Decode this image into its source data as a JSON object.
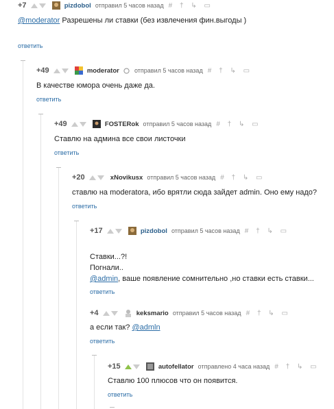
{
  "colors": {
    "link": "#2a6ca6",
    "user": "#2a5e8a",
    "arrow": "#cccccc",
    "arrow_up_active": "#8fc24a"
  },
  "tools_glyph": "# † ↳ ▭",
  "c0": {
    "rating": "+7",
    "user": "pizdobol",
    "sent": "отправил 5 часов назад",
    "mention": "@moderator",
    "text": "Разрешены ли ставки (без извлечения фин.выгоды )",
    "reply": "ответить"
  },
  "c1": {
    "rating": "+49",
    "user": "moderator",
    "sent": "отправил 5 часов назад",
    "text": "В качестве юмора очень даже да.",
    "reply": "ответить"
  },
  "c2": {
    "rating": "+49",
    "user": "FOSTERok",
    "sent": "отправил 5 часов назад",
    "text": "Ставлю на админа все свои листочки",
    "reply": "ответить"
  },
  "c3": {
    "rating": "+20",
    "user": "xNovikusx",
    "sent": "отправил 5 часов назад",
    "text": "ставлю на moderatora, ибо врятли сюда зайдет admin. Оно ему надо?",
    "reply": "ответить"
  },
  "c4": {
    "rating": "+17",
    "user": "pizdobol",
    "sent": "отправил 5 часов назад",
    "line1": "Ставки...?!",
    "line2": "Погнали..",
    "mention": "@admin",
    "line3": ", ваше появление сомнительно ,но ставки есть ставки...",
    "reply": "ответить"
  },
  "c5": {
    "rating": "+4",
    "user": "keksmario",
    "sent": "отправил 5 часов назад",
    "text": "а если так?",
    "mention": "@admln",
    "reply": "ответить"
  },
  "c6": {
    "rating": "+15",
    "user": "autofellator",
    "sent": "отправлено 4 часа назад",
    "text": "Ставлю 100 плюсов что он появится.",
    "reply": "ответить"
  }
}
